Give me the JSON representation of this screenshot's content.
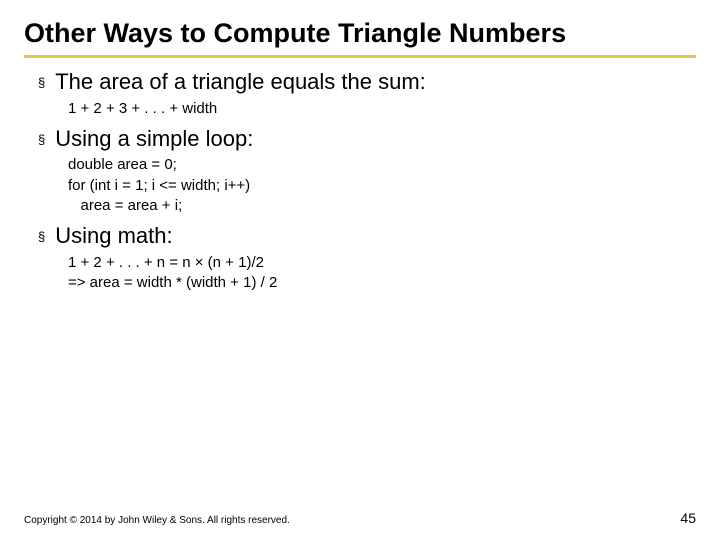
{
  "slide": {
    "title": "Other Ways to Compute Triangle Numbers",
    "bullets": [
      {
        "text": "The area of a triangle equals the sum:",
        "sub": "1 + 2 + 3 + . . . + width"
      },
      {
        "text": "Using a simple loop:",
        "sub": "double area = 0;\nfor (int i = 1; i <= width; i++)\n   area = area + i;"
      },
      {
        "text": "Using math:",
        "sub": "1 + 2 + . . . + n = n × (n + 1)/2\n=> area = width * (width + 1) / 2"
      }
    ]
  },
  "footer": {
    "copyright": "Copyright © 2014 by John Wiley & Sons. All rights reserved.",
    "page": "45"
  },
  "glyphs": {
    "bullet": "§"
  }
}
